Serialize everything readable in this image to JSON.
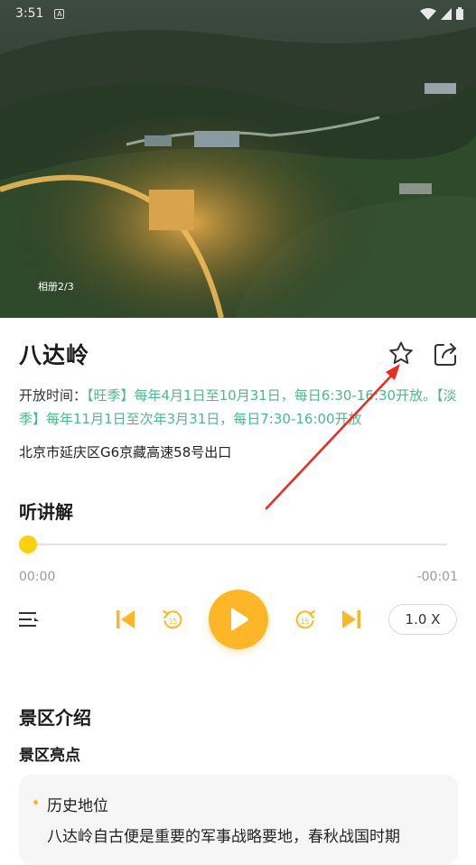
{
  "status_bar": {
    "time": "3:51",
    "notification_glyph": "A"
  },
  "hero": {
    "album_counter": "相册2/3"
  },
  "attraction": {
    "name": "八达岭",
    "hours_label": "开放时间：",
    "hours_value": "【旺季】每年4月1日至10月31日，每日6:30-16:30开放。【淡季】每年11月1日至次年3月31日，每日7:30-16:00开放",
    "address": "北京市延庆区G6京藏高速58号出口"
  },
  "audio_guide": {
    "title": "听讲解",
    "progress": 0,
    "current_time": "00:00",
    "remaining_time": "-00:01",
    "skip_back_seconds": "15",
    "skip_forward_seconds": "15",
    "speed": "1.0 X"
  },
  "intro": {
    "title": "景区介绍",
    "highlights_title": "景区亮点",
    "items": [
      {
        "heading": "历史地位",
        "text": "八达岭自古便是重要的军事战略要地，春秋战国时期"
      }
    ]
  },
  "colors": {
    "accent": "#fcb628",
    "accent_light": "#fdd10f",
    "hours_text": "#4ab98c",
    "annotation_arrow": "#ee2a24"
  },
  "icons": [
    "star-outline-icon",
    "share-icon",
    "playlist-icon",
    "skip-previous-icon",
    "rewind-15-icon",
    "play-icon",
    "forward-15-icon",
    "skip-next-icon"
  ]
}
